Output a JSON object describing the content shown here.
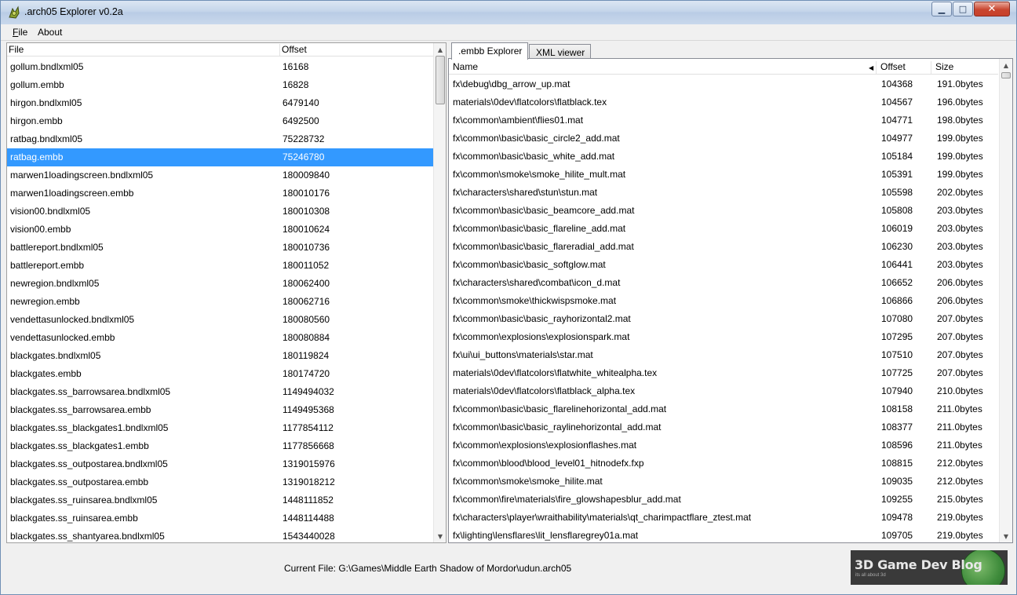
{
  "window": {
    "title": ".arch05 Explorer v0.2a",
    "controls": {
      "minimize": "▁",
      "maximize": "□",
      "close": "✕"
    }
  },
  "menu": {
    "file": "File",
    "about": "About"
  },
  "left_list": {
    "columns": {
      "file": "File",
      "offset": "Offset"
    },
    "selected_index": 5,
    "rows": [
      {
        "file": "gollum.bndlxml05",
        "offset": "16168"
      },
      {
        "file": "gollum.embb",
        "offset": "16828"
      },
      {
        "file": "hirgon.bndlxml05",
        "offset": "6479140"
      },
      {
        "file": "hirgon.embb",
        "offset": "6492500"
      },
      {
        "file": "ratbag.bndlxml05",
        "offset": "75228732"
      },
      {
        "file": "ratbag.embb",
        "offset": "75246780"
      },
      {
        "file": "marwen1loadingscreen.bndlxml05",
        "offset": "180009840"
      },
      {
        "file": "marwen1loadingscreen.embb",
        "offset": "180010176"
      },
      {
        "file": "vision00.bndlxml05",
        "offset": "180010308"
      },
      {
        "file": "vision00.embb",
        "offset": "180010624"
      },
      {
        "file": "battlereport.bndlxml05",
        "offset": "180010736"
      },
      {
        "file": "battlereport.embb",
        "offset": "180011052"
      },
      {
        "file": "newregion.bndlxml05",
        "offset": "180062400"
      },
      {
        "file": "newregion.embb",
        "offset": "180062716"
      },
      {
        "file": "vendettasunlocked.bndlxml05",
        "offset": "180080560"
      },
      {
        "file": "vendettasunlocked.embb",
        "offset": "180080884"
      },
      {
        "file": "blackgates.bndlxml05",
        "offset": "180119824"
      },
      {
        "file": "blackgates.embb",
        "offset": "180174720"
      },
      {
        "file": "blackgates.ss_barrowsarea.bndlxml05",
        "offset": "1149494032"
      },
      {
        "file": "blackgates.ss_barrowsarea.embb",
        "offset": "1149495368"
      },
      {
        "file": "blackgates.ss_blackgates1.bndlxml05",
        "offset": "1177854112"
      },
      {
        "file": "blackgates.ss_blackgates1.embb",
        "offset": "1177856668"
      },
      {
        "file": "blackgates.ss_outpostarea.bndlxml05",
        "offset": "1319015976"
      },
      {
        "file": "blackgates.ss_outpostarea.embb",
        "offset": "1319018212"
      },
      {
        "file": "blackgates.ss_ruinsarea.bndlxml05",
        "offset": "1448111852"
      },
      {
        "file": "blackgates.ss_ruinsarea.embb",
        "offset": "1448114488"
      },
      {
        "file": "blackgates.ss_shantyarea.bndlxml05",
        "offset": "1543440028"
      }
    ]
  },
  "tabs": [
    {
      "label": ".embb Explorer",
      "active": true
    },
    {
      "label": "XML viewer",
      "active": false
    }
  ],
  "right_list": {
    "columns": {
      "name": "Name",
      "offset": "Offset",
      "size": "Size"
    },
    "rows": [
      {
        "name": "fx\\debug\\dbg_arrow_up.mat",
        "offset": "104368",
        "size": "191.0bytes"
      },
      {
        "name": "materials\\0dev\\flatcolors\\flatblack.tex",
        "offset": "104567",
        "size": "196.0bytes"
      },
      {
        "name": "fx\\common\\ambient\\flies01.mat",
        "offset": "104771",
        "size": "198.0bytes"
      },
      {
        "name": "fx\\common\\basic\\basic_circle2_add.mat",
        "offset": "104977",
        "size": "199.0bytes"
      },
      {
        "name": "fx\\common\\basic\\basic_white_add.mat",
        "offset": "105184",
        "size": "199.0bytes"
      },
      {
        "name": "fx\\common\\smoke\\smoke_hilite_mult.mat",
        "offset": "105391",
        "size": "199.0bytes"
      },
      {
        "name": "fx\\characters\\shared\\stun\\stun.mat",
        "offset": "105598",
        "size": "202.0bytes"
      },
      {
        "name": "fx\\common\\basic\\basic_beamcore_add.mat",
        "offset": "105808",
        "size": "203.0bytes"
      },
      {
        "name": "fx\\common\\basic\\basic_flareline_add.mat",
        "offset": "106019",
        "size": "203.0bytes"
      },
      {
        "name": "fx\\common\\basic\\basic_flareradial_add.mat",
        "offset": "106230",
        "size": "203.0bytes"
      },
      {
        "name": "fx\\common\\basic\\basic_softglow.mat",
        "offset": "106441",
        "size": "203.0bytes"
      },
      {
        "name": "fx\\characters\\shared\\combat\\icon_d.mat",
        "offset": "106652",
        "size": "206.0bytes"
      },
      {
        "name": "fx\\common\\smoke\\thickwispsmoke.mat",
        "offset": "106866",
        "size": "206.0bytes"
      },
      {
        "name": "fx\\common\\basic\\basic_rayhorizontal2.mat",
        "offset": "107080",
        "size": "207.0bytes"
      },
      {
        "name": "fx\\common\\explosions\\explosionspark.mat",
        "offset": "107295",
        "size": "207.0bytes"
      },
      {
        "name": "fx\\ui\\ui_buttons\\materials\\star.mat",
        "offset": "107510",
        "size": "207.0bytes"
      },
      {
        "name": "materials\\0dev\\flatcolors\\flatwhite_whitealpha.tex",
        "offset": "107725",
        "size": "207.0bytes"
      },
      {
        "name": "materials\\0dev\\flatcolors\\flatblack_alpha.tex",
        "offset": "107940",
        "size": "210.0bytes"
      },
      {
        "name": "fx\\common\\basic\\basic_flarelinehorizontal_add.mat",
        "offset": "108158",
        "size": "211.0bytes"
      },
      {
        "name": "fx\\common\\basic\\basic_raylinehorizontal_add.mat",
        "offset": "108377",
        "size": "211.0bytes"
      },
      {
        "name": "fx\\common\\explosions\\explosionflashes.mat",
        "offset": "108596",
        "size": "211.0bytes"
      },
      {
        "name": "fx\\common\\blood\\blood_level01_hitnodefx.fxp",
        "offset": "108815",
        "size": "212.0bytes"
      },
      {
        "name": "fx\\common\\smoke\\smoke_hilite.mat",
        "offset": "109035",
        "size": "212.0bytes"
      },
      {
        "name": "fx\\common\\fire\\materials\\fire_glowshapesblur_add.mat",
        "offset": "109255",
        "size": "215.0bytes"
      },
      {
        "name": "fx\\characters\\player\\wraithability\\materials\\qt_charimpactflare_ztest.mat",
        "offset": "109478",
        "size": "219.0bytes"
      },
      {
        "name": "fx\\lighting\\lensflares\\lit_lensflaregrey01a.mat",
        "offset": "109705",
        "size": "219.0bytes"
      }
    ]
  },
  "status": {
    "current_file": "Current File: G:\\Games\\Middle Earth Shadow of Mordor\\udun.arch05"
  },
  "logo": {
    "text": "3D Game Dev Blog",
    "sub": "its all about 3d"
  },
  "colors": {
    "selection": "#3399ff",
    "title_bar": "#c4d5ea",
    "close_button": "#c8452f"
  }
}
